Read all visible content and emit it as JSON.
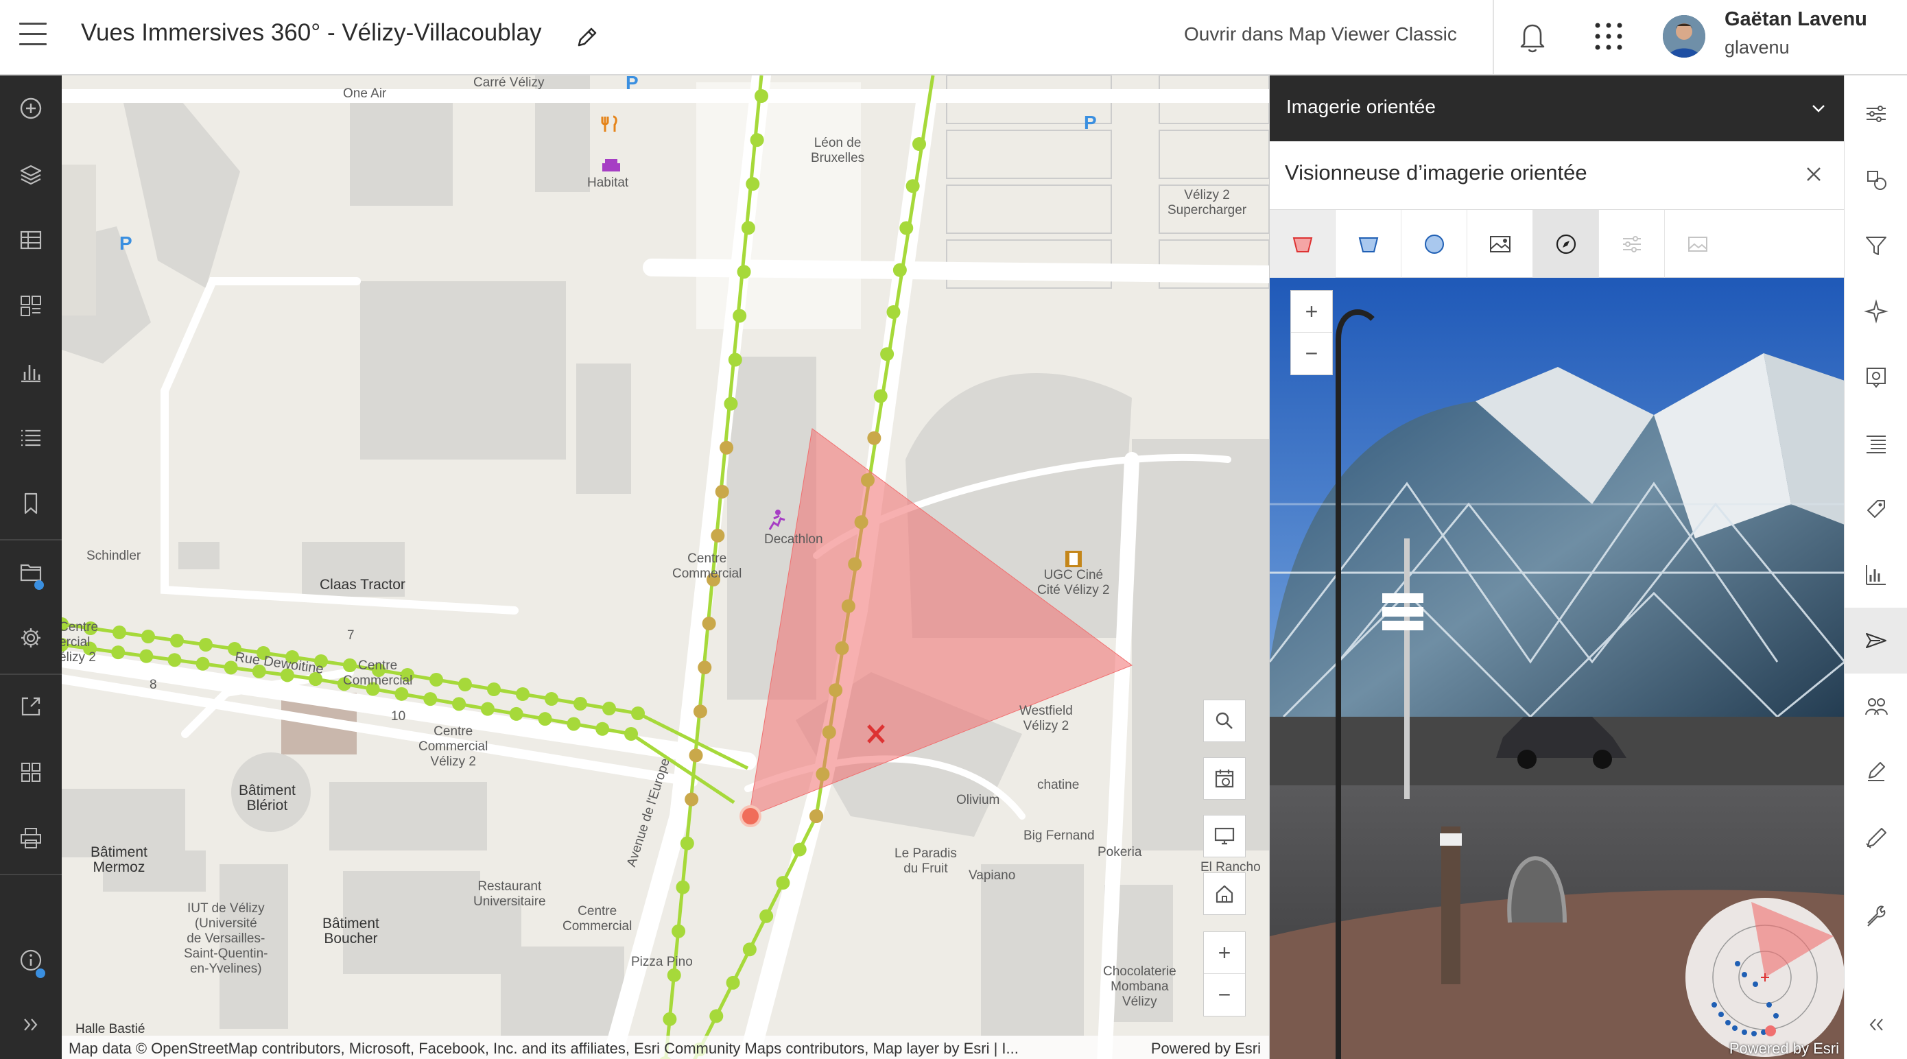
{
  "header": {
    "title": "Vues Immersives 360° - Vélizy-Villacoublay",
    "open_classic": "Ouvrir dans Map Viewer Classic",
    "user_name": "Gaëtan Lavenu",
    "user_id": "glavenu"
  },
  "map": {
    "labels": {
      "carre_velizy": "Carré Vélizy",
      "one_air": "One Air",
      "habitat": "Habitat",
      "leon": "Léon de\nBruxelles",
      "velizy2_super": "Vélizy 2\nSupercharger",
      "schindler": "Schindler",
      "claas": "Claas Tractor",
      "decathlon": "Decathlon",
      "centre_commercial_1": "Centre\nCommercial",
      "ugc": "UGC Ciné\nCité Vélizy 2",
      "rue_dewoitine": "Rue Dewoitine",
      "centre_commercial_2": "Centre\nCommercial",
      "centre_velizy2_a": "Centre\nCommercial\nVélizy 2",
      "centre_velizy2_left": "Centre\nercial\nélizy 2",
      "batiment_bleriot": "Bâtiment\nBlériot",
      "batiment_mermoz": "Bâtiment\nMermoz",
      "restaurant_univ": "Restaurant\nUniversitaire",
      "iut": "IUT de Vélizy\n(Université\nde Versailles-\nSaint-Quentin-\nen-Yvelines)",
      "batiment_boucher": "Bâtiment\nBoucher",
      "centre_commercial_3": "Centre\nCommercial",
      "pizza_pino": "Pizza Pino",
      "halle_bastie": "Halle Bastié",
      "westfield": "Westfield\nVélizy 2",
      "olivium": "Olivium",
      "chatine": "chatine",
      "big_fernand": "Big Fernand",
      "pokeria": "Pokeria",
      "paradis": "Le Paradis\ndu Fruit",
      "vapiano": "Vapiano",
      "el_rancho": "El Rancho",
      "chocolaterie": "Chocolaterie\nMombana\nVélizy",
      "avenue_europe": "Avenue de l'Europe",
      "num_7": "7",
      "num_8": "8",
      "num_10": "10",
      "parking": "P"
    },
    "attribution": "Map data © OpenStreetMap contributors, Microsoft, Facebook, Inc. and its affiliates, Esri Community Maps contributors, Map layer by Esri | I...",
    "powered": "Powered by Esri"
  },
  "panel": {
    "dropdown_title": "Imagerie orientée",
    "viewer_title": "Visionneuse d’imagerie orientée",
    "zoom_in": "+",
    "zoom_out": "−",
    "powered": "Powered by Esri"
  },
  "map_controls": {
    "zoom_in": "+",
    "zoom_out": "−"
  },
  "colors": {
    "header_bg": "#ffffff",
    "dark_bar": "#2b2b2b",
    "track_green": "#a6d93a",
    "fov_red": "#f07070",
    "accent_blue": "#3a8fe0"
  }
}
